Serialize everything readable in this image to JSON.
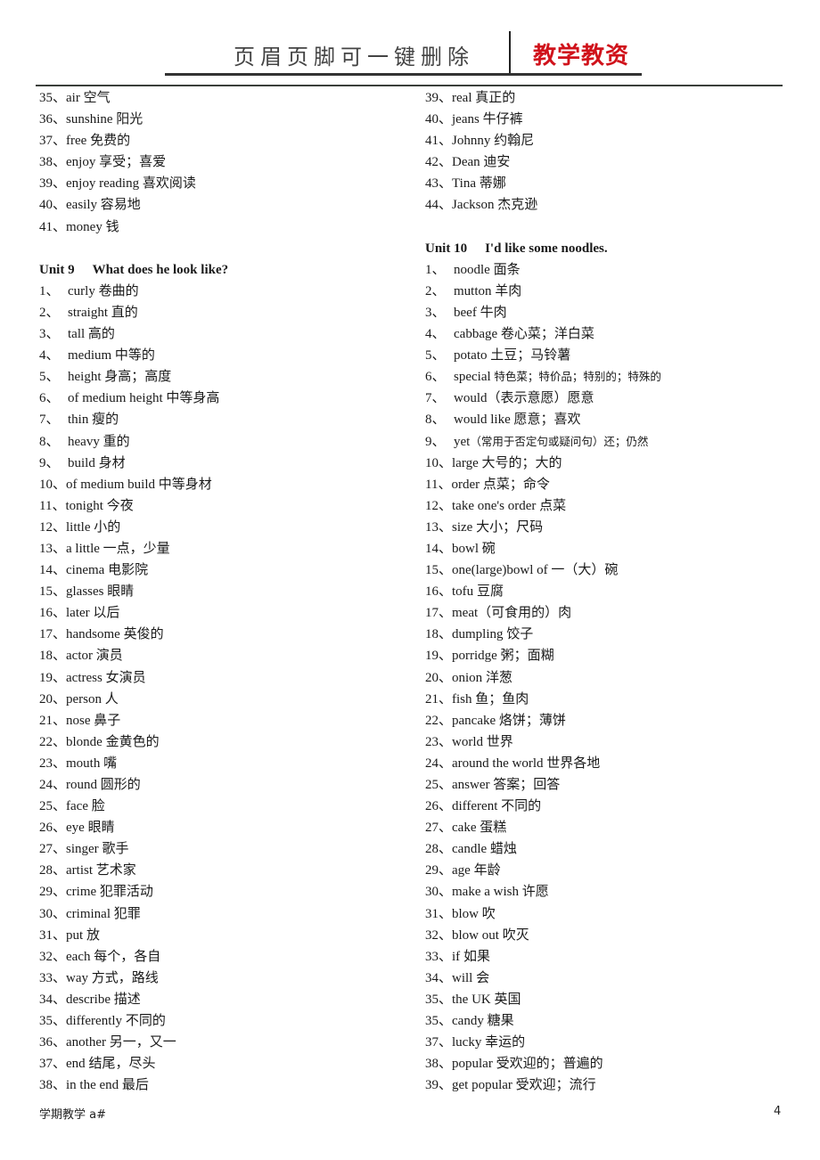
{
  "header": {
    "left_text": "页眉页脚可一键删除",
    "right_text": "教学教资",
    "right_color": "#d0121b"
  },
  "left_column": {
    "top_items": [
      {
        "num": "35、",
        "en": "air",
        "zh": "空气"
      },
      {
        "num": "36、",
        "en": "sunshine",
        "zh": "阳光"
      },
      {
        "num": "37、",
        "en": "free",
        "zh": "免费的"
      },
      {
        "num": "38、",
        "en": "enjoy",
        "zh": "享受；喜爱"
      },
      {
        "num": "39、",
        "en": "enjoy reading",
        "zh": "喜欢阅读"
      },
      {
        "num": "40、",
        "en": "easily",
        "zh": "容易地"
      },
      {
        "num": "41、",
        "en": "money",
        "zh": "钱"
      }
    ],
    "unit_heading": {
      "unit": "Unit 9",
      "title": "What does he look like?"
    },
    "unit_items": [
      {
        "num": "1、",
        "en": "curly",
        "zh": "卷曲的"
      },
      {
        "num": "2、",
        "en": "straight",
        "zh": "直的"
      },
      {
        "num": "3、",
        "en": "tall",
        "zh": "高的"
      },
      {
        "num": "4、",
        "en": "medium",
        "zh": "中等的"
      },
      {
        "num": "5、",
        "en": "height",
        "zh": "身高；高度"
      },
      {
        "num": "6、",
        "en": "of medium height",
        "zh": "中等身高"
      },
      {
        "num": "7、",
        "en": "thin",
        "zh": "瘦的"
      },
      {
        "num": "8、",
        "en": "heavy",
        "zh": "重的"
      },
      {
        "num": "9、",
        "en": "build",
        "zh": "身材"
      },
      {
        "num": "10、",
        "en": "of medium build",
        "zh": "中等身材"
      },
      {
        "num": "11、",
        "en": "tonight",
        "zh": "今夜"
      },
      {
        "num": "12、",
        "en": "little",
        "zh": "小的"
      },
      {
        "num": "13、",
        "en": "a little",
        "zh": "一点，少量"
      },
      {
        "num": "14、",
        "en": "cinema",
        "zh": "电影院"
      },
      {
        "num": "15、",
        "en": "glasses",
        "zh": "眼睛"
      },
      {
        "num": "16、",
        "en": "later",
        "zh": "以后"
      },
      {
        "num": "17、",
        "en": "handsome",
        "zh": "英俊的"
      },
      {
        "num": "18、",
        "en": "actor",
        "zh": "演员"
      },
      {
        "num": "19、",
        "en": "actress",
        "zh": "女演员"
      },
      {
        "num": "20、",
        "en": "person",
        "zh": "人"
      },
      {
        "num": "21、",
        "en": "nose",
        "zh": "鼻子"
      },
      {
        "num": "22、",
        "en": "blonde",
        "zh": "金黄色的"
      },
      {
        "num": "23、",
        "en": "mouth",
        "zh": "嘴"
      },
      {
        "num": "24、",
        "en": "round",
        "zh": "圆形的"
      },
      {
        "num": "25、",
        "en": "face",
        "zh": "脸"
      },
      {
        "num": "26、",
        "en": "eye",
        "zh": "眼睛"
      },
      {
        "num": "27、",
        "en": "singer",
        "zh": "歌手"
      },
      {
        "num": "28、",
        "en": "artist",
        "zh": "艺术家"
      },
      {
        "num": "29、",
        "en": "crime",
        "zh": "犯罪活动"
      },
      {
        "num": "30、",
        "en": "criminal",
        "zh": "犯罪"
      },
      {
        "num": "31、",
        "en": "put",
        "zh": "放"
      },
      {
        "num": "32、",
        "en": "each",
        "zh": "每个，各自"
      },
      {
        "num": "33、",
        "en": "way",
        "zh": "方式，路线"
      },
      {
        "num": "34、",
        "en": "describe",
        "zh": "描述"
      },
      {
        "num": "35、",
        "en": "differently",
        "zh": "不同的"
      },
      {
        "num": "36、",
        "en": "another",
        "zh": "另一，又一"
      },
      {
        "num": "37、",
        "en": "end",
        "zh": "结尾，尽头"
      },
      {
        "num": "38、",
        "en": "in the end",
        "zh": "最后"
      }
    ]
  },
  "right_column": {
    "top_items": [
      {
        "num": "39、",
        "en": "real",
        "zh": "真正的"
      },
      {
        "num": "40、",
        "en": "jeans",
        "zh": "牛仔裤"
      },
      {
        "num": "41、",
        "en": "Johnny",
        "zh": "约翰尼"
      },
      {
        "num": "42、",
        "en": "Dean",
        "zh": "迪安"
      },
      {
        "num": "43、",
        "en": "Tina",
        "zh": "蒂娜"
      },
      {
        "num": "44、",
        "en": "Jackson",
        "zh": "杰克逊"
      }
    ],
    "unit_heading": {
      "unit": "Unit 10",
      "title": "I'd like some noodles."
    },
    "unit_items": [
      {
        "num": "1、",
        "en": "noodle",
        "zh": "面条"
      },
      {
        "num": "2、",
        "en": "mutton",
        "zh": "羊肉"
      },
      {
        "num": "3、",
        "en": "beef",
        "zh": "牛肉"
      },
      {
        "num": "4、",
        "en": "cabbage",
        "zh": "卷心菜；洋白菜"
      },
      {
        "num": "5、",
        "en": "potato",
        "zh": "土豆；马铃薯"
      },
      {
        "num": "6、",
        "en": "special",
        "zh": "特色菜；特价品；特别的；特殊的",
        "small": true
      },
      {
        "num": "7、",
        "en": "would",
        "zh": "（表示意愿）愿意"
      },
      {
        "num": "8、",
        "en": "would like",
        "zh": "愿意；喜欢"
      },
      {
        "num": "9、",
        "en": "yet",
        "zh": "（常用于否定句或疑问句）还；仍然",
        "small": true
      },
      {
        "num": "10、",
        "en": "large",
        "zh": "大号的；大的"
      },
      {
        "num": "11、",
        "en": "order",
        "zh": "点菜；命令"
      },
      {
        "num": "12、",
        "en": "take one's order",
        "zh": "点菜"
      },
      {
        "num": "13、",
        "en": "size",
        "zh": "大小；尺码"
      },
      {
        "num": "14、",
        "en": "bowl",
        "zh": "碗"
      },
      {
        "num": "15、",
        "en": "one(large)bowl of",
        "zh": "一（大）碗"
      },
      {
        "num": "16、",
        "en": "tofu",
        "zh": "豆腐"
      },
      {
        "num": "17、",
        "en": "meat",
        "zh": "（可食用的）肉"
      },
      {
        "num": "18、",
        "en": "dumpling",
        "zh": "饺子"
      },
      {
        "num": "19、",
        "en": "porridge",
        "zh": "粥；面糊"
      },
      {
        "num": "20、",
        "en": "onion",
        "zh": "洋葱"
      },
      {
        "num": "21、",
        "en": "fish",
        "zh": "鱼；鱼肉"
      },
      {
        "num": "22、",
        "en": "pancake",
        "zh": "烙饼；薄饼"
      },
      {
        "num": "23、",
        "en": "world",
        "zh": "世界"
      },
      {
        "num": "24、",
        "en": "around the world",
        "zh": "世界各地"
      },
      {
        "num": "25、",
        "en": "answer",
        "zh": "答案；回答"
      },
      {
        "num": "26、",
        "en": "different",
        "zh": "不同的"
      },
      {
        "num": "27、",
        "en": "cake",
        "zh": "蛋糕"
      },
      {
        "num": "28、",
        "en": "candle",
        "zh": "蜡烛"
      },
      {
        "num": "29、",
        "en": "age",
        "zh": "年龄"
      },
      {
        "num": "30、",
        "en": "make a wish",
        "zh": "许愿"
      },
      {
        "num": "31、",
        "en": "blow",
        "zh": "吹"
      },
      {
        "num": "32、",
        "en": "blow out",
        "zh": "吹灭"
      },
      {
        "num": "33、",
        "en": "if",
        "zh": "如果"
      },
      {
        "num": "34、",
        "en": "will",
        "zh": "会"
      },
      {
        "num": "35、",
        "en": "the UK",
        "zh": "英国"
      },
      {
        "num": "35、",
        "en": "candy",
        "zh": "糖果"
      },
      {
        "num": "37、",
        "en": "lucky",
        "zh": "幸运的"
      },
      {
        "num": "38、",
        "en": "popular",
        "zh": "受欢迎的；普遍的"
      },
      {
        "num": "39、",
        "en": "get popular",
        "zh": "受欢迎；流行"
      }
    ]
  },
  "footer": {
    "left_text": "学期教学 a#",
    "page_number": "4"
  }
}
